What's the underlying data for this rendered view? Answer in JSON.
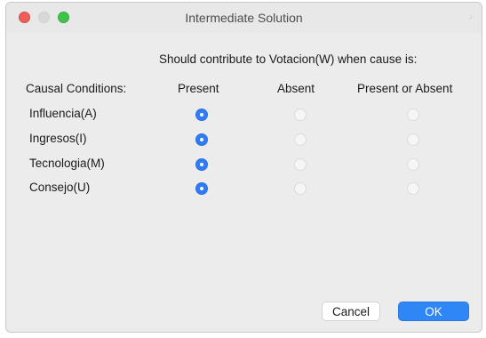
{
  "window": {
    "title": "Intermediate Solution"
  },
  "prompt": "Should contribute to Votacion(W) when cause is:",
  "columns": {
    "conditions": "Causal Conditions:",
    "present": "Present",
    "absent": "Absent",
    "either": "Present or Absent"
  },
  "conditions": [
    {
      "label": "Influencia(A)",
      "selected": "present"
    },
    {
      "label": "Ingresos(I)",
      "selected": "present"
    },
    {
      "label": "Tecnologia(M)",
      "selected": "present"
    },
    {
      "label": "Consejo(U)",
      "selected": "present"
    }
  ],
  "buttons": {
    "cancel": "Cancel",
    "ok": "OK"
  },
  "colors": {
    "accent": "#2e7cf6",
    "close": "#ee5d57",
    "zoom": "#3fc34a"
  }
}
